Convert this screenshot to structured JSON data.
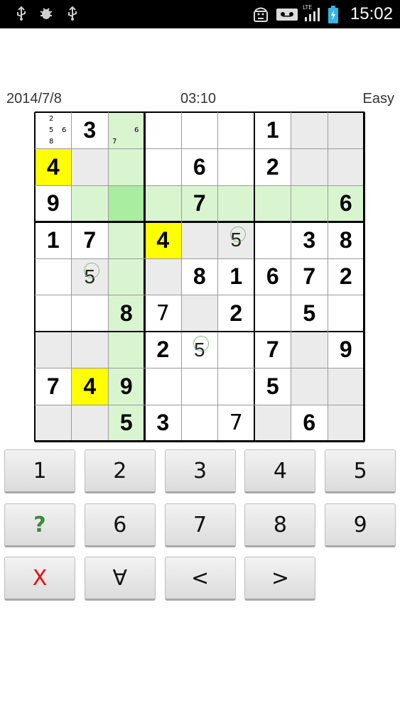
{
  "status_bar": {
    "time": "15:02",
    "network": "LTE",
    "icons": [
      "usb-icon",
      "debug-icon",
      "usb-icon",
      "android-icon",
      "voicemail-icon",
      "signal-icon",
      "battery-icon"
    ]
  },
  "header": {
    "date": "2014/7/8",
    "timer": "03:10",
    "difficulty": "Easy"
  },
  "board": {
    "rows": [
      [
        "",
        "3",
        "",
        "",
        "",
        "",
        "1",
        "",
        ""
      ],
      [
        "4",
        "",
        "",
        "",
        "6",
        "",
        "2",
        "",
        ""
      ],
      [
        "9",
        "",
        "",
        "",
        "7",
        "",
        "",
        "",
        "6"
      ],
      [
        "1",
        "7",
        "",
        "4",
        "",
        "5",
        "",
        "3",
        "8"
      ],
      [
        "",
        "5",
        "",
        "",
        "8",
        "1",
        "6",
        "7",
        "2"
      ],
      [
        "",
        "",
        "8",
        "7",
        "",
        "2",
        "",
        "5",
        ""
      ],
      [
        "",
        "",
        "",
        "2",
        "5",
        "",
        "7",
        "",
        "9"
      ],
      [
        "7",
        "4",
        "9",
        "",
        "",
        "",
        "5",
        "",
        ""
      ],
      [
        "",
        "",
        "5",
        "3",
        "",
        "7",
        "",
        "6",
        ""
      ]
    ],
    "notes": {
      "r0c0": [
        "2",
        "5",
        "6",
        "8"
      ],
      "r0c2": [
        "6",
        "7"
      ]
    },
    "colors": {
      "given_white": "#ffffff",
      "empty_grey": "#ebebeb",
      "highlight_green": "#d9f5d0",
      "selected_green": "#a8eda0",
      "yellow": "#ffff00"
    }
  },
  "keypad": {
    "row1": [
      "1",
      "2",
      "3",
      "4",
      "5"
    ],
    "row2": [
      "?",
      "6",
      "7",
      "8",
      "9"
    ],
    "row3": [
      "X",
      "∀",
      "<",
      ">"
    ]
  }
}
